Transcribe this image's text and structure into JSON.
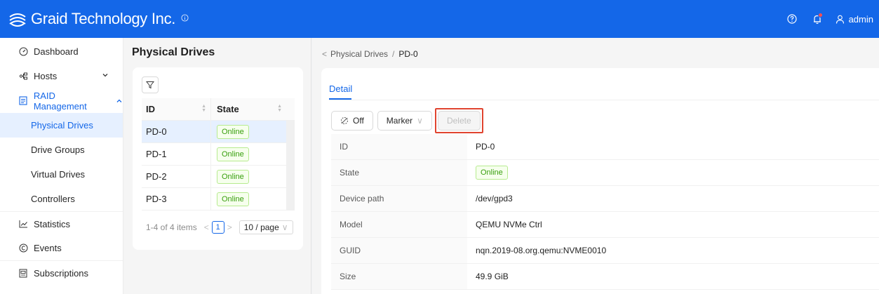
{
  "header": {
    "brand": "Graid Technology Inc.",
    "user": "admin",
    "colors": {
      "bar": "#1467e8",
      "notification_dot": "#ff4d4f"
    },
    "icons": [
      "logo-icon",
      "info-icon",
      "help-icon",
      "bell-icon",
      "user-icon"
    ]
  },
  "sidebar": {
    "items": [
      {
        "label": "Dashboard",
        "icon": "dashboard-icon"
      },
      {
        "label": "Hosts",
        "icon": "hosts-icon"
      },
      {
        "label": "RAID Management",
        "icon": "raid-icon"
      },
      {
        "label": "Physical Drives"
      },
      {
        "label": "Drive Groups"
      },
      {
        "label": "Virtual Drives"
      },
      {
        "label": "Controllers"
      },
      {
        "label": "Statistics",
        "icon": "chart-icon"
      },
      {
        "label": "Events",
        "icon": "events-icon"
      },
      {
        "label": "Subscriptions",
        "icon": "subscriptions-icon"
      }
    ],
    "active": "Physical Drives"
  },
  "list": {
    "title": "Physical Drives",
    "columns": [
      "ID",
      "State"
    ],
    "rows": [
      {
        "id": "PD-0",
        "state": "Online"
      },
      {
        "id": "PD-1",
        "state": "Online"
      },
      {
        "id": "PD-2",
        "state": "Online"
      },
      {
        "id": "PD-3",
        "state": "Online"
      }
    ],
    "pagination": {
      "summary": "1-4 of 4 items",
      "page": "1",
      "page_size": "10 / page"
    }
  },
  "detail": {
    "breadcrumb": {
      "parent": "Physical Drives",
      "separator": "/",
      "current": "PD-0"
    },
    "tab": "Detail",
    "actions": {
      "off": "Off",
      "marker": "Marker",
      "delete": "Delete"
    },
    "fields": [
      {
        "label": "ID",
        "value": "PD-0"
      },
      {
        "label": "State",
        "value": "Online"
      },
      {
        "label": "Device path",
        "value": "/dev/gpd3"
      },
      {
        "label": "Model",
        "value": "QEMU NVMe Ctrl"
      },
      {
        "label": "GUID",
        "value": "nqn.2019-08.org.qemu:NVME0010"
      },
      {
        "label": "Size",
        "value": "49.9 GiB"
      }
    ]
  }
}
